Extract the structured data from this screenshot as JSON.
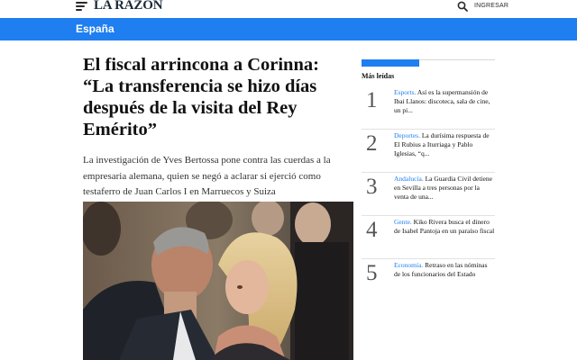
{
  "header": {
    "logo_text": "LA RAZÓN",
    "login_label": "INGRESAR"
  },
  "section": {
    "label": "España",
    "accent_color": "#1f7ef0"
  },
  "article": {
    "headline": "El fiscal arrincona a Corinna: “La transferencia se hizo días después de la visita del Rey Emérito”",
    "summary": "La investigación de Yves Bertossa pone contra las cuerdas a la empresaria alemana, quien se negó a aclarar si ejerció como testaferro de Juan Carlos I en Marruecos y Suiza"
  },
  "sidebar": {
    "title": "Más leídas",
    "items": [
      {
        "number": "1",
        "category": "Esports.",
        "text": "Así es la supermansión de Ibai Llanos: discoteca, sala de cine, un pi..."
      },
      {
        "number": "2",
        "category": "Deportes.",
        "text": "La durísima respuesta de El Rubius a Iturriaga y Pablo Iglesias, “q..."
      },
      {
        "number": "3",
        "category": "Andalucía.",
        "text": "La Guardia Civil detiene en Sevilla a tres personas por la venta de una..."
      },
      {
        "number": "4",
        "category": "Gente.",
        "text": "Kiko Rivera busca el dinero de Isabel Pantoja en un paraíso fiscal"
      },
      {
        "number": "5",
        "category": "Economía.",
        "text": "Retraso en las nóminas de los funcionarios del Estado"
      }
    ]
  },
  "icons": {
    "menu": "hamburger-menu-icon",
    "search": "search-icon"
  }
}
